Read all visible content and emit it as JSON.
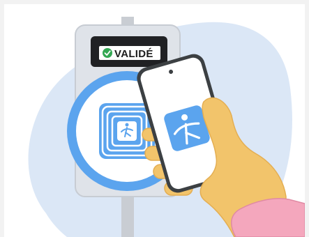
{
  "validator": {
    "screen_text": "VALIDÉ",
    "check_icon": "check-circle-icon"
  },
  "phone": {
    "app_icon": "transit-app-icon"
  },
  "colors": {
    "blob": "#dbe7f6",
    "validator_body": "#dfe3e9",
    "validator_pole": "#c9cdd3",
    "screen_bg": "#202124",
    "check_green": "#34a853",
    "nfc_blue": "#5ba4ee",
    "nfc_light": "#d7e8fb",
    "phone_frame": "#3c4043",
    "skin": "#f2c46b",
    "skin_shade": "#e4ae52",
    "sleeve": "#f4a7bd"
  }
}
